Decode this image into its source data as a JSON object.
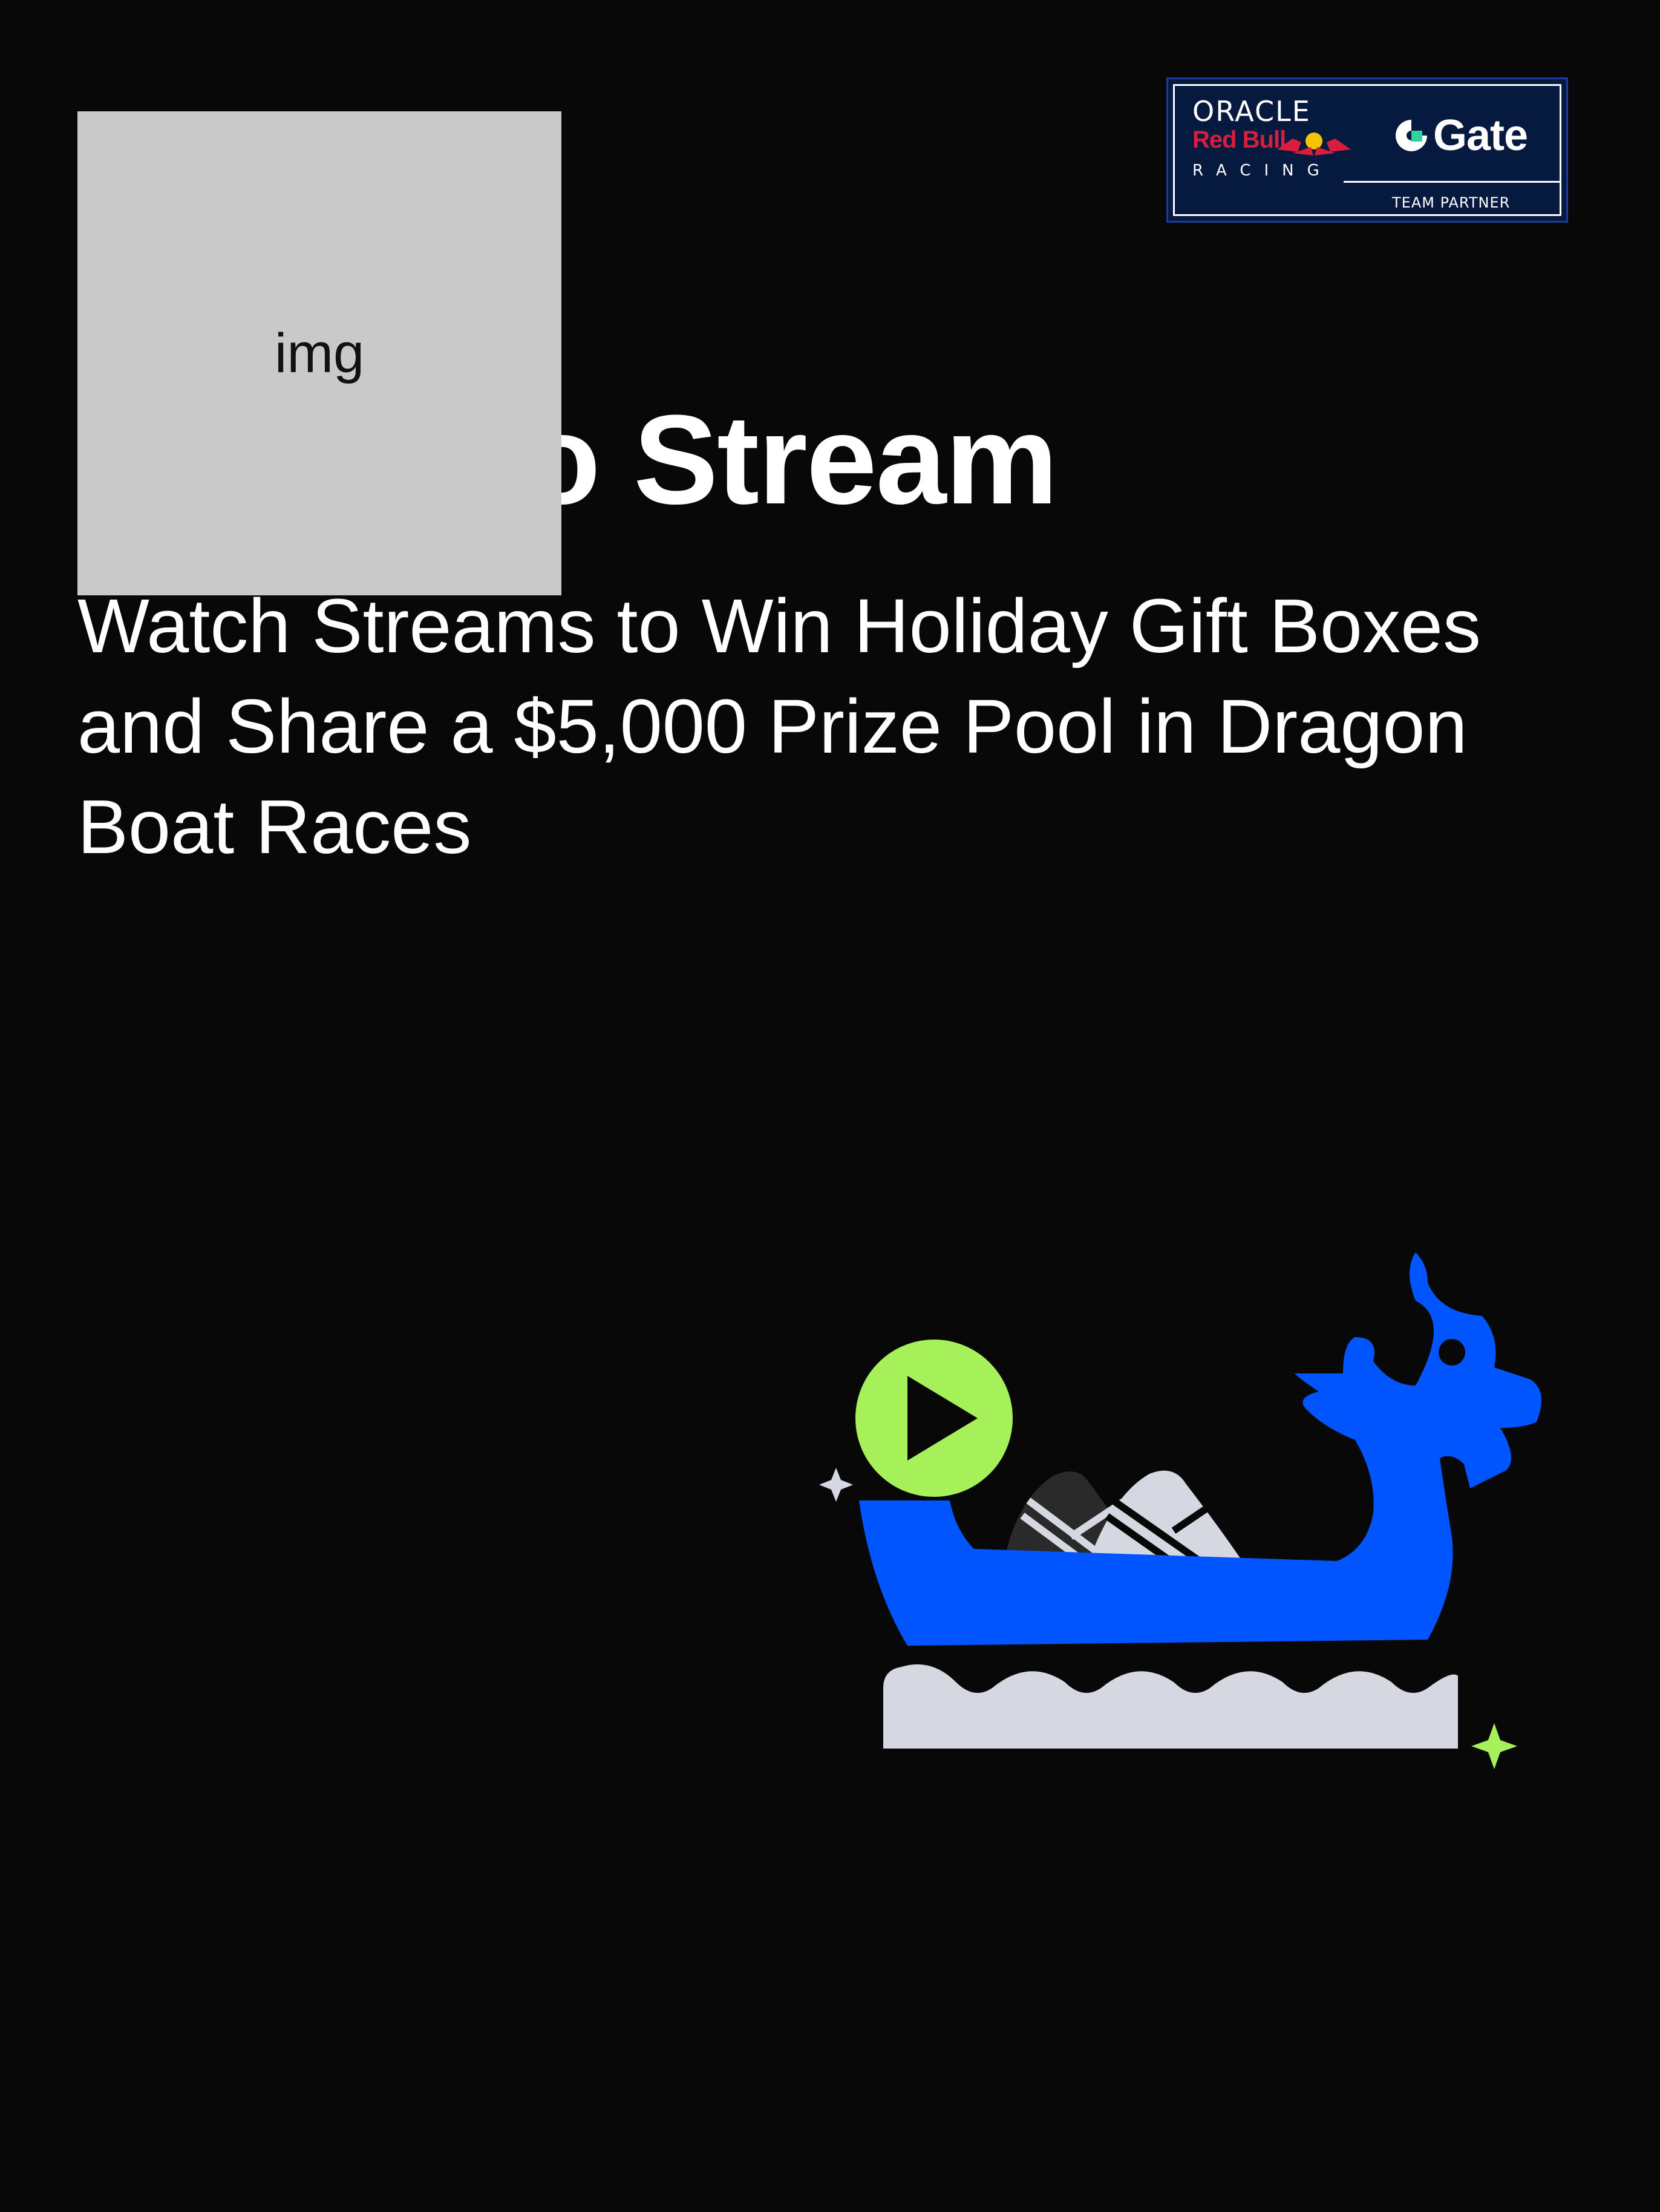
{
  "partner_badge": {
    "oracle": "ORACLE",
    "redbull": "Red Bull",
    "racing": "RACING",
    "gate": "Gate",
    "team_partner": "TEAM PARTNER"
  },
  "image_placeholder": {
    "label": "img"
  },
  "hero": {
    "title": "Watch to Stream",
    "subtitle": "Watch Streams to Win Holiday Gift Boxes and Share a $5,000 Prize Pool in Dragon Boat Races"
  },
  "colors": {
    "background": "#080808",
    "dragon_blue": "#0055ff",
    "play_green": "#a6f05a",
    "wave_gray": "#d5d8e0",
    "dumpling_dark": "#2a2a2a"
  },
  "icons": {
    "play": "play-icon",
    "sparkle": "sparkle-icon",
    "gate": "gate-icon",
    "bull": "bull-icon"
  }
}
